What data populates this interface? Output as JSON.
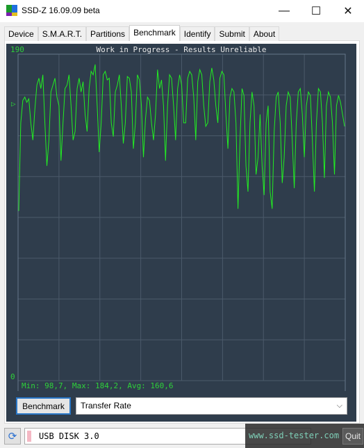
{
  "window": {
    "title": "SSD-Z 16.09.09 beta",
    "minimize": "—",
    "maximize": "☐",
    "close": "✕"
  },
  "tabs": [
    {
      "label": "Device"
    },
    {
      "label": "S.M.A.R.T."
    },
    {
      "label": "Partitions"
    },
    {
      "label": "Benchmark",
      "active": true
    },
    {
      "label": "Identify"
    },
    {
      "label": "Submit"
    },
    {
      "label": "About"
    }
  ],
  "chart_data": {
    "type": "line",
    "title": "Work in Progress - Results Unreliable",
    "ylim": [
      0,
      190
    ],
    "ytick_labels": [
      "190",
      "0"
    ],
    "grid": true,
    "line_color": "#22ee22",
    "avg_marker": "▷",
    "stats": "Min: 98,7, Max: 184,2, Avg: 160,6",
    "min": 98.7,
    "max": 184.2,
    "avg": 160.6,
    "values": [
      98.7,
      150,
      163,
      165,
      162,
      164,
      150,
      140,
      158,
      172,
      176,
      170,
      178,
      150,
      125,
      140,
      168,
      172,
      176,
      165,
      160,
      128,
      150,
      170,
      172,
      178,
      160,
      140,
      145,
      170,
      176,
      168,
      174,
      155,
      145,
      170,
      180,
      178,
      184,
      160,
      133,
      150,
      178,
      180,
      175,
      176,
      150,
      142,
      168,
      172,
      178,
      160,
      138,
      150,
      177,
      176,
      168,
      135,
      150,
      178,
      175,
      160,
      130,
      152,
      165,
      163,
      150,
      140,
      155,
      181,
      170,
      175,
      160,
      128,
      160,
      178,
      176,
      160,
      140,
      170,
      178,
      172,
      150,
      150,
      176,
      180,
      178,
      165,
      140,
      174,
      181,
      178,
      160,
      148,
      150,
      174,
      182,
      175,
      160,
      150,
      176,
      180,
      178,
      155,
      135,
      165,
      170,
      168,
      150,
      100,
      140,
      170,
      166,
      125,
      110,
      150,
      168,
      160,
      120,
      130,
      155,
      125,
      108,
      150,
      160,
      110,
      100,
      145,
      165,
      168,
      150,
      115,
      130,
      160,
      168,
      165,
      140,
      112,
      150,
      168,
      170,
      155,
      130,
      160,
      168,
      166,
      140,
      110,
      150,
      170,
      168,
      150,
      118,
      160,
      168,
      165,
      150,
      120,
      160,
      166,
      162,
      155,
      148
    ]
  },
  "controls": {
    "benchmark_button": "Benchmark",
    "mode_select": "Transfer Rate"
  },
  "footer": {
    "drive": "USB DISK 3.0",
    "quit": "Quit",
    "watermark": "www.ssd-tester.com"
  }
}
